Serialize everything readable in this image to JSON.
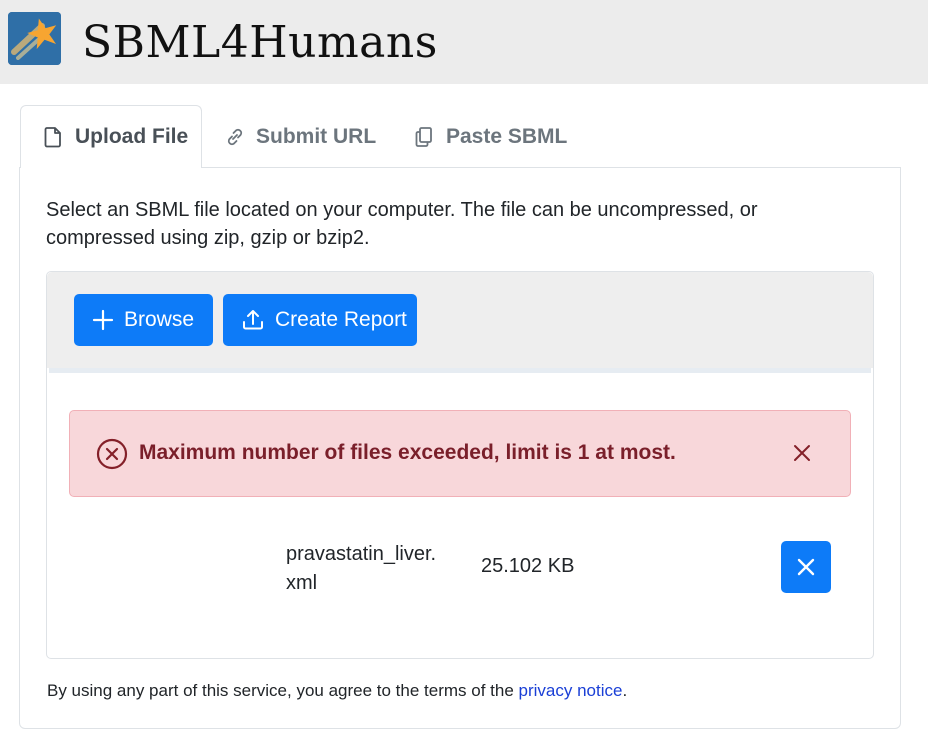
{
  "app": {
    "title": "SBML4Humans"
  },
  "tabs": [
    {
      "label": "Upload File",
      "icon": "file-icon",
      "active": true
    },
    {
      "label": "Submit URL",
      "icon": "link-icon",
      "active": false
    },
    {
      "label": "Paste SBML",
      "icon": "copy-icon",
      "active": false
    }
  ],
  "upload": {
    "intro": "Select an SBML file located on your computer. The file can be uncompressed, or compressed using zip, gzip or bzip2.",
    "browse_label": "Browse",
    "create_report_label": "Create Report",
    "error_message": "Maximum number of files exceeded, limit is 1 at most.",
    "file": {
      "name": "pravastatin_liver.xml",
      "size": "25.102 KB"
    }
  },
  "footer": {
    "text": "By using any part of this service, you agree to the terms of the ",
    "link_text": "privacy notice",
    "suffix": "."
  },
  "colors": {
    "primary": "#0d7bf8",
    "error_bg": "#f8d7da",
    "error_text": "#7a1f2a",
    "header_bg": "#ececec"
  }
}
